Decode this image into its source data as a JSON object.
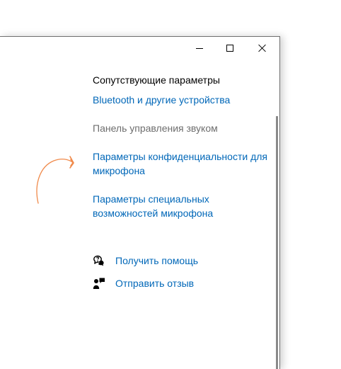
{
  "window": {
    "buttons": {
      "minimize": "minimize",
      "maximize": "maximize",
      "close": "close"
    }
  },
  "related": {
    "title": "Сопутствующие параметры",
    "links": [
      {
        "label": "Bluetooth и другие устройства",
        "enabled": true
      },
      {
        "label": "Панель управления звуком",
        "enabled": false
      },
      {
        "label": "Параметры конфиденциальности для микрофона",
        "enabled": true
      },
      {
        "label": "Параметры специальных возможностей микрофона",
        "enabled": true
      }
    ]
  },
  "support": {
    "help_label": "Получить помощь",
    "help_icon": "help-chat-icon",
    "feedback_label": "Отправить отзыв",
    "feedback_icon": "feedback-icon"
  },
  "annotation": {
    "icon": "hand-drawn-arrow",
    "color": "#f08a4b"
  },
  "colors": {
    "link": "#0067b8",
    "disabled": "#6d6d6d",
    "text": "#000000"
  }
}
